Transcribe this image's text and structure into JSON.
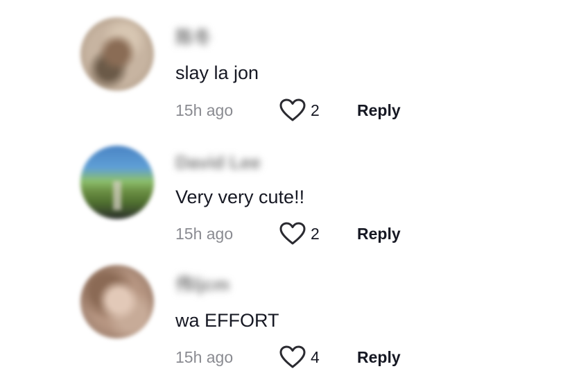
{
  "comments": [
    {
      "username": "陈冬",
      "text": "slay la jon",
      "time": "15h ago",
      "likes": "2",
      "reply_label": "Reply"
    },
    {
      "username": "David Lee",
      "text": "Very very cute!!",
      "time": "15h ago",
      "likes": "2",
      "reply_label": "Reply"
    },
    {
      "username": "伟ljcm",
      "text": "wa EFFORT",
      "time": "15h ago",
      "likes": "4",
      "reply_label": "Reply"
    }
  ],
  "colors": {
    "text_primary": "#161823",
    "text_secondary": "#8a8b91"
  },
  "icons": {
    "like": "heart-outline-icon"
  }
}
